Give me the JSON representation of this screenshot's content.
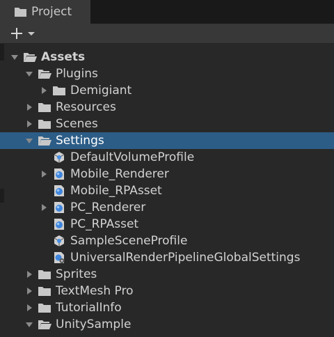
{
  "window": {
    "tab_label": "Project",
    "tab_icon": "folder-icon"
  },
  "toolbar": {
    "create_button": "plus-icon",
    "create_dropdown": "caret-down-icon"
  },
  "tree": {
    "rows": [
      {
        "label": "Assets",
        "icon": "folder-open-icon",
        "arrow": "expanded",
        "depth": 0,
        "bold": true
      },
      {
        "label": "Plugins",
        "icon": "folder-open-icon",
        "arrow": "expanded",
        "depth": 1
      },
      {
        "label": "Demigiant",
        "icon": "folder-icon",
        "arrow": "collapsed",
        "depth": 2
      },
      {
        "label": "Resources",
        "icon": "folder-icon",
        "arrow": "collapsed",
        "depth": 1
      },
      {
        "label": "Scenes",
        "icon": "folder-icon",
        "arrow": "collapsed",
        "depth": 1
      },
      {
        "label": "Settings",
        "icon": "folder-open-icon",
        "arrow": "expanded",
        "depth": 1,
        "selected": true
      },
      {
        "label": "DefaultVolumeProfile",
        "icon": "volume-profile-icon",
        "arrow": "none",
        "depth": 2
      },
      {
        "label": "Mobile_Renderer",
        "icon": "renderer-asset-icon",
        "arrow": "collapsed",
        "depth": 2
      },
      {
        "label": "Mobile_RPAsset",
        "icon": "pipeline-asset-icon",
        "arrow": "none",
        "depth": 2
      },
      {
        "label": "PC_Renderer",
        "icon": "renderer-asset-icon",
        "arrow": "collapsed",
        "depth": 2
      },
      {
        "label": "PC_RPAsset",
        "icon": "pipeline-asset-icon",
        "arrow": "none",
        "depth": 2
      },
      {
        "label": "SampleSceneProfile",
        "icon": "volume-profile-icon",
        "arrow": "none",
        "depth": 2
      },
      {
        "label": "UniversalRenderPipelineGlobalSettings",
        "icon": "global-settings-icon",
        "arrow": "none",
        "depth": 2
      },
      {
        "label": "Sprites",
        "icon": "folder-icon",
        "arrow": "collapsed",
        "depth": 1
      },
      {
        "label": "TextMesh Pro",
        "icon": "folder-icon",
        "arrow": "collapsed",
        "depth": 1
      },
      {
        "label": "TutorialInfo",
        "icon": "folder-icon",
        "arrow": "collapsed",
        "depth": 1
      },
      {
        "label": "UnitySample",
        "icon": "folder-open-icon",
        "arrow": "expanded",
        "depth": 1
      },
      {
        "label": "",
        "icon": "folder-icon",
        "arrow": "collapsed",
        "depth": 2
      }
    ]
  },
  "colors": {
    "selection": "#2c5d87",
    "tree_background": "#282828",
    "text": "#d2d2d2",
    "icon_blue": "#4a8fe0"
  }
}
